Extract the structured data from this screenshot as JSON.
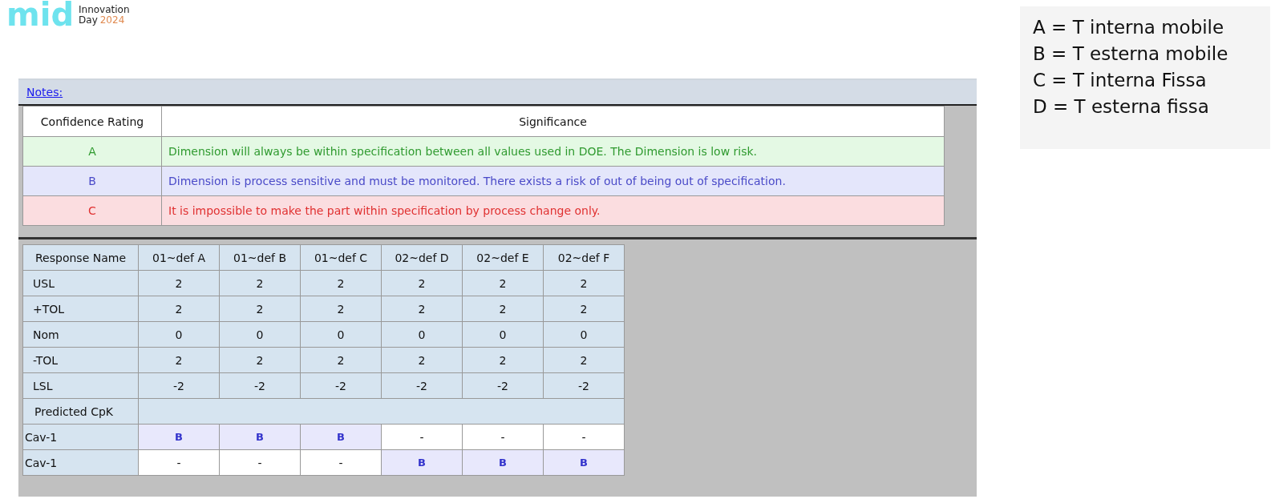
{
  "logo": {
    "mark": "mid",
    "lines": [
      "Innovation",
      "Day"
    ],
    "year": "2024"
  },
  "notes": {
    "link": "Notes:",
    "columns": [
      "Confidence Rating",
      "Significance"
    ],
    "rows": [
      {
        "rating": "A",
        "kind": "low",
        "text": "Dimension will always be within specification between all values used in DOE. The Dimension is low risk."
      },
      {
        "rating": "B",
        "kind": "medium",
        "text": "Dimension is process sensitive and must be monitored. There exists a risk of out of being out of specification."
      },
      {
        "rating": "C",
        "kind": "high",
        "text": "It is impossible to make the part within specification by process change only."
      }
    ]
  },
  "response_table": {
    "columns": [
      "Response Name",
      "01~def A",
      "01~def B",
      "01~def C",
      "02~def D",
      "02~def E",
      "02~def F"
    ],
    "rows": [
      {
        "name": "USL",
        "values": [
          "2",
          "2",
          "2",
          "2",
          "2",
          "2"
        ]
      },
      {
        "name": "+TOL",
        "values": [
          "2",
          "2",
          "2",
          "2",
          "2",
          "2"
        ]
      },
      {
        "name": "Nom",
        "values": [
          "0",
          "0",
          "0",
          "0",
          "0",
          "0"
        ]
      },
      {
        "name": "-TOL",
        "values": [
          "2",
          "2",
          "2",
          "2",
          "2",
          "2"
        ]
      },
      {
        "name": "LSL",
        "values": [
          "-2",
          "-2",
          "-2",
          "-2",
          "-2",
          "-2"
        ]
      }
    ],
    "section": "Predicted CpK",
    "cavities": [
      {
        "name": "Cav-1",
        "cells": [
          {
            "text": "B",
            "highlighted": true
          },
          {
            "text": "B",
            "highlighted": true
          },
          {
            "text": "B",
            "highlighted": true
          },
          {
            "text": "-",
            "highlighted": false
          },
          {
            "text": "-",
            "highlighted": false
          },
          {
            "text": "-",
            "highlighted": false
          }
        ]
      },
      {
        "name": "Cav-1",
        "cells": [
          {
            "text": "-",
            "highlighted": false
          },
          {
            "text": "-",
            "highlighted": false
          },
          {
            "text": "-",
            "highlighted": false
          },
          {
            "text": "B",
            "highlighted": true
          },
          {
            "text": "B",
            "highlighted": true
          },
          {
            "text": "B",
            "highlighted": true
          }
        ]
      }
    ]
  },
  "legend": [
    "A = T interna mobile",
    "B = T esterna mobile",
    "C = T interna Fissa",
    "D = T esterna fissa"
  ]
}
